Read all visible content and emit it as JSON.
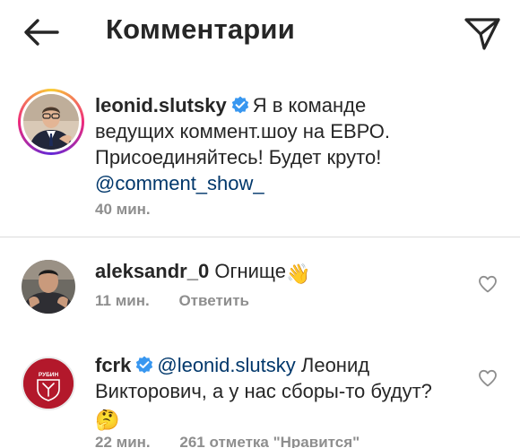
{
  "header": {
    "title": "Комментарии",
    "back_icon": "arrow-left-icon",
    "send_icon": "paper-plane-icon"
  },
  "caption": {
    "username": "leonid.slutsky",
    "verified": true,
    "text": "Я в команде ведущих коммент.шоу на ЕВРО. Присоединяйтесь! Будет круто!",
    "mention": "@comment_show_",
    "time": "40 мин."
  },
  "comments": [
    {
      "username": "aleksandr_0",
      "text": "Огнище",
      "emoji": "👋",
      "time": "11 мин.",
      "reply_label": "Ответить",
      "like_icon": "heart-outline-icon"
    },
    {
      "username": "fcrk",
      "verified": true,
      "mention": "@leonid.slutsky",
      "text": "Леонид Викторович, а у нас сборы-то будут?",
      "emoji": "🤔",
      "time": "22 мин.",
      "likes_label": "261 отметка \"Нравится\"",
      "like_icon": "heart-outline-icon",
      "avatar_text": "РУБИН"
    }
  ],
  "colors": {
    "text": "#262626",
    "secondary": "#8e8e8e",
    "mention": "#00376b",
    "verified": "#3897f0",
    "fcrk_red": "#b3182b"
  }
}
